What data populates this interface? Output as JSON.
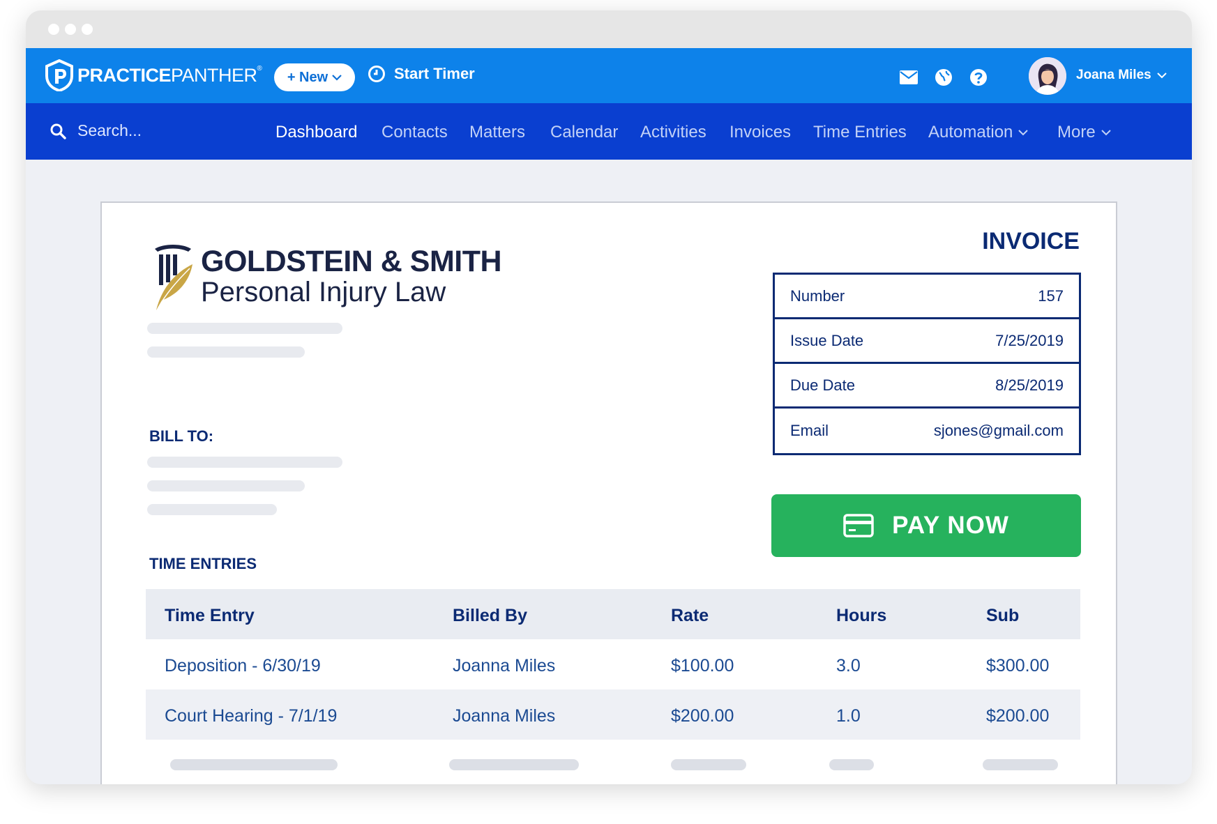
{
  "app": {
    "brand_bold": "PRACTICE",
    "brand_light": "PANTHER",
    "brand_mark": "®",
    "new_button": "+ New",
    "start_timer": "Start Timer",
    "user_name": "Joana Miles",
    "colors": {
      "topbar": "#0d82ea",
      "navbar": "#0a3fd0",
      "pay": "#26b25d",
      "navy": "#0b2a73"
    },
    "icons": [
      "mail-icon",
      "globe-icon",
      "help-icon",
      "clock-icon",
      "search-icon",
      "credit-card-icon"
    ]
  },
  "search": {
    "placeholder": "Search..."
  },
  "nav": {
    "dashboard": "Dashboard",
    "contacts": "Contacts",
    "matters": "Matters",
    "calendar": "Calendar",
    "activities": "Activities",
    "invoices": "Invoices",
    "time_entries": "Time Entries",
    "automation": "Automation",
    "more": "More"
  },
  "invoice": {
    "firm_name": "GOLDSTEIN & SMITH",
    "firm_sub": "Personal Injury Law",
    "title": "INVOICE",
    "bill_to": "BILL TO:",
    "meta": [
      {
        "label": "Number",
        "value": "157"
      },
      {
        "label": "Issue Date",
        "value": "7/25/2019"
      },
      {
        "label": "Due Date",
        "value": "8/25/2019"
      },
      {
        "label": "Email",
        "value": "sjones@gmail.com"
      }
    ],
    "pay_now": "PAY NOW",
    "time_entries_title": "TIME ENTRIES",
    "columns": [
      "Time Entry",
      "Billed By",
      "Rate",
      "Hours",
      "Sub"
    ],
    "rows": [
      [
        "Deposition - 6/30/19",
        "Joanna Miles",
        "$100.00",
        "3.0",
        "$300.00"
      ],
      [
        "Court Hearing - 7/1/19",
        "Joanna Miles",
        "$200.00",
        "1.0",
        "$200.00"
      ]
    ]
  }
}
